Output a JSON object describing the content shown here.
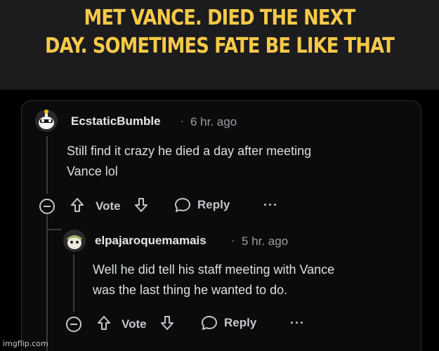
{
  "caption": "MET VANCE. DIED THE NEXT\nDAY. SOMETIMES FATE BE LIKE THAT",
  "comments": [
    {
      "username": "EcstaticBumble",
      "separator": "·",
      "time": "6 hr. ago",
      "body_line1": "Still find it crazy he died a day after meeting",
      "body_line2": "Vance lol",
      "vote_label": "Vote",
      "reply_label": "Reply",
      "more_label": "···",
      "avatar_icon": "snoo-avatar-icon"
    },
    {
      "username": "elpajaroquemamais",
      "separator": "·",
      "time": "5 hr. ago",
      "body_line1": "Well he did tell his staff meeting with Vance",
      "body_line2": "was the last thing he wanted to do.",
      "vote_label": "Vote",
      "reply_label": "Reply",
      "more_label": "···",
      "avatar_icon": "snoo-avatar-icon"
    }
  ],
  "watermark": "imgflip.com",
  "colors": {
    "caption": "#f7c948",
    "background": "#0b0b0c",
    "text": "#dcdfe2",
    "muted": "#9a9ea3"
  }
}
